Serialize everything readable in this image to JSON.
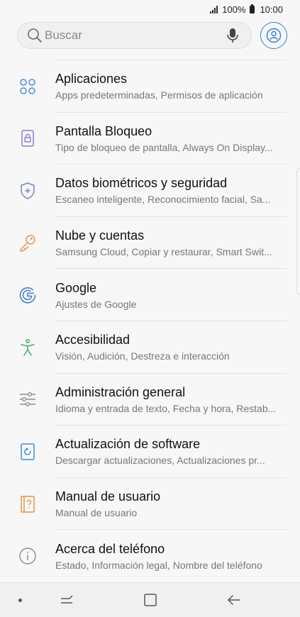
{
  "status_bar": {
    "battery": "100%",
    "time": "10:00",
    "icons": [
      "signal-icon",
      "battery-icon"
    ]
  },
  "search": {
    "placeholder": "Buscar",
    "icons": [
      "search-icon",
      "mic-icon",
      "profile-icon"
    ]
  },
  "accent_colors": {
    "blue": "#4a90d9",
    "purple": "#8a7ad6",
    "orange": "#e8944a",
    "green": "#3fae5e",
    "gray": "#8c8c8c"
  },
  "settings": [
    {
      "icon": "apps-icon",
      "title": "Aplicaciones",
      "subtitle": "Apps predeterminadas, Permisos de aplicación"
    },
    {
      "icon": "lock-screen-icon",
      "title": "Pantalla Bloqueo",
      "subtitle": "Tipo de bloqueo de pantalla, Always On Display..."
    },
    {
      "icon": "shield-icon",
      "title": "Datos biométricos y seguridad",
      "subtitle": "Escaneo inteligente, Reconocimiento facial, Sa..."
    },
    {
      "icon": "key-icon",
      "title": "Nube y cuentas",
      "subtitle": "Samsung Cloud, Copiar y restaurar, Smart Swit..."
    },
    {
      "icon": "google-icon",
      "title": "Google",
      "subtitle": "Ajustes de Google"
    },
    {
      "icon": "accessibility-icon",
      "title": "Accesibilidad",
      "subtitle": "Visión, Audición, Destreza e interacción"
    },
    {
      "icon": "sliders-icon",
      "title": "Administración general",
      "subtitle": "Idioma y entrada de texto, Fecha y hora, Restab..."
    },
    {
      "icon": "software-update-icon",
      "title": "Actualización de software",
      "subtitle": "Descargar actualizaciones, Actualizaciones pr..."
    },
    {
      "icon": "user-manual-icon",
      "title": "Manual de usuario",
      "subtitle": "Manual de usuario"
    },
    {
      "icon": "info-icon",
      "title": "Acerca del teléfono",
      "subtitle": "Estado, Información legal, Nombre del teléfono"
    }
  ],
  "nav_bar": {
    "icons": [
      "nav-dot-icon",
      "recent-apps-icon",
      "home-icon",
      "back-icon"
    ]
  }
}
